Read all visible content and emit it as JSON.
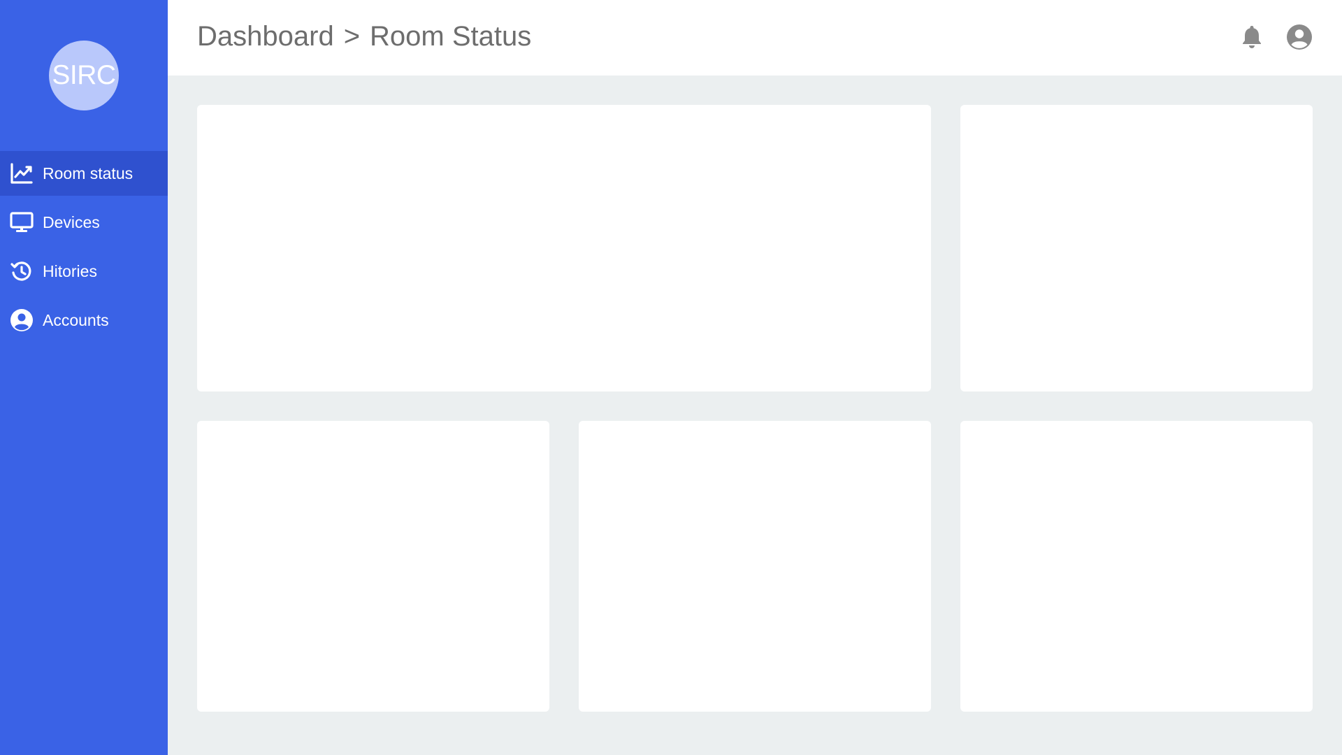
{
  "sidebar": {
    "logo_text": "SIRC",
    "items": [
      {
        "label": "Room status",
        "icon": "chart-line-icon",
        "active": true
      },
      {
        "label": "Devices",
        "icon": "monitor-icon",
        "active": false
      },
      {
        "label": "Hitories",
        "icon": "history-icon",
        "active": false
      },
      {
        "label": "Accounts",
        "icon": "user-circle-icon",
        "active": false
      }
    ]
  },
  "header": {
    "breadcrumb": [
      "Dashboard",
      ">",
      "Room Status"
    ],
    "icons": [
      "bell-icon",
      "user-circle-icon"
    ]
  },
  "colors": {
    "sidebar": "#3a62e6",
    "sidebar_active": "#2f51cf",
    "logo_bg": "#b9c8fb",
    "content_bg": "#ebeff0",
    "header_bg": "#ffffff",
    "text_muted": "#6d6d6d",
    "icon_gray": "#8a8a8a"
  }
}
